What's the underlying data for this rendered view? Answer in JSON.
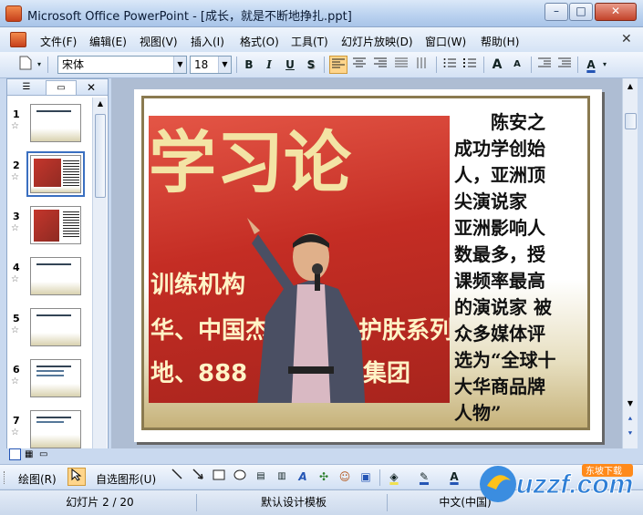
{
  "window": {
    "title": "Microsoft Office PowerPoint - [成长，就是不断地挣扎.ppt]",
    "minimize_label": "–",
    "maximize_label": "□",
    "close_label": "✕"
  },
  "menu": {
    "items": [
      "文件(F)",
      "编辑(E)",
      "视图(V)",
      "插入(I)",
      "格式(O)",
      "工具(T)",
      "幻灯片放映(D)",
      "窗口(W)",
      "帮助(H)"
    ],
    "doc_close": "✕"
  },
  "toolbar": {
    "font_name": "宋体",
    "font_size": "18",
    "bold": "B",
    "italic": "I",
    "underline": "U",
    "shadow": "S",
    "grow_font": "A",
    "shrink_font": "A",
    "font_color": "A"
  },
  "slides_pane": {
    "slide_numbers": [
      "1",
      "2",
      "3",
      "4",
      "5",
      "6",
      "7"
    ],
    "selected": "2"
  },
  "slide": {
    "text": "陈安之成功学创始人，亚洲顶尖演说家 亚洲影响人数最多，授课频率最高的演说家 被众多媒体评选为“全球十大华商品牌人物”",
    "text_lines": [
      "陈安之",
      "成功学创始",
      "人，亚洲顶",
      "尖演说家",
      "亚洲影响人",
      "数最多，授",
      "课频率最高",
      "的演说家 被",
      "众多媒体评",
      "选为“全球十",
      "大华商品牌",
      "人物”"
    ],
    "photo_banner_top": "学习论",
    "photo_banner_line1": "训练机构",
    "photo_banner_line2": "华、中国杰",
    "photo_banner_line3": "护肤系列",
    "photo_banner_line4": "地、888",
    "photo_banner_line5": "集团"
  },
  "drawing_toolbar": {
    "draw_label": "绘图(R)",
    "autoshapes_label": "自选图形(U)"
  },
  "status": {
    "slide_position": "幻灯片 2 / 20",
    "template": "默认设计模板",
    "language": "中文(中国)"
  },
  "watermark": {
    "text": "uzzf.com",
    "sub": "东坡下载"
  },
  "colors": {
    "accent": "#3a6fc0",
    "photo_red": "#c42d24",
    "frame_gold": "#8a7a50"
  }
}
